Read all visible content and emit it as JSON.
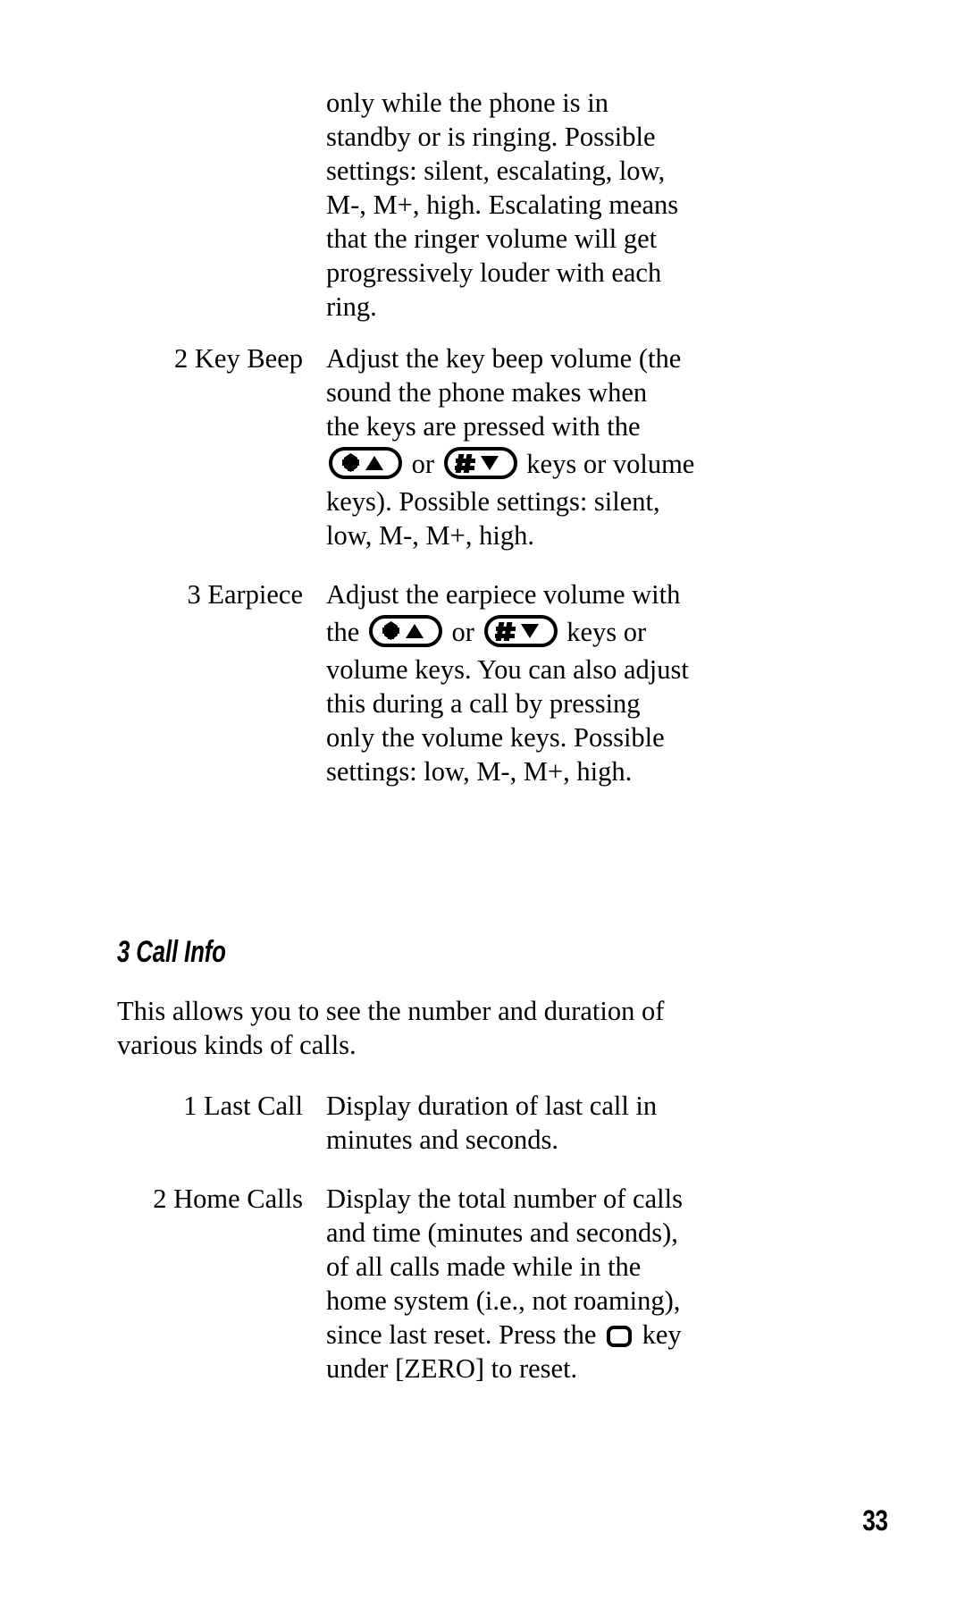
{
  "page": {
    "number": "33",
    "background_color": "#ffffff",
    "text_color": "#000000"
  },
  "continued_paragraph": {
    "name": "ringer-volume-continued",
    "lines": [
      "only while the phone is in",
      "standby or is ringing. Possible",
      "settings: silent, escalating, low,",
      "M-, M+, high. Escalating means",
      "that the ringer volume will get",
      "progressively louder with each",
      "ring."
    ]
  },
  "ringer_items": [
    {
      "term": "2 Key Beep",
      "lines": [
        {
          "text": "Adjust the key beep volume (the"
        },
        {
          "text": "sound the phone makes when"
        },
        {
          "text": "the keys are pressed with the"
        },
        {
          "segments": [
            {
              "icon": "star-up-key-icon"
            },
            {
              "text": " or "
            },
            {
              "icon": "pound-down-key-icon"
            },
            {
              "text": " keys or volume"
            }
          ]
        },
        {
          "text": "keys). Possible settings:  silent,"
        },
        {
          "text": "low, M-, M+, high."
        }
      ]
    },
    {
      "term": "3 Earpiece",
      "lines": [
        {
          "text": "Adjust the earpiece volume with"
        },
        {
          "segments": [
            {
              "text": "the "
            },
            {
              "icon": "star-up-key-icon"
            },
            {
              "text": " or "
            },
            {
              "icon": "pound-down-key-icon"
            },
            {
              "text": " keys or"
            }
          ]
        },
        {
          "text": "volume keys. You can also adjust"
        },
        {
          "text": "this during a call by pressing"
        },
        {
          "text": "only the volume keys. Possible"
        },
        {
          "text": "settings:  low, M-, M+, high."
        }
      ]
    }
  ],
  "call_info_section": {
    "heading": "3 Call Info",
    "intro_lines": [
      "This allows you to see the number and duration of",
      "various kinds of calls."
    ],
    "items": [
      {
        "term": "1 Last Call",
        "lines": [
          {
            "text": "Display duration of last call in"
          },
          {
            "text": "minutes and seconds."
          }
        ]
      },
      {
        "term": "2 Home Calls",
        "lines": [
          {
            "text": "Display the total number of calls"
          },
          {
            "text": "and time (minutes and seconds),"
          },
          {
            "text": "of all calls made while in the"
          },
          {
            "text": "home system (i.e., not roaming),"
          },
          {
            "segments": [
              {
                "text": "since last reset. Press the "
              },
              {
                "icon": "softkey-icon"
              },
              {
                "text": " key"
              }
            ]
          },
          {
            "text": "under [ZERO] to reset."
          }
        ]
      }
    ]
  },
  "icons": {
    "star-up-key-icon": {
      "label": "star and up arrow key",
      "glyphs": "✱▲"
    },
    "pound-down-key-icon": {
      "label": "pound and down arrow key",
      "glyphs": "#▼"
    },
    "softkey-icon": {
      "label": "soft key",
      "glyphs": "□"
    }
  }
}
